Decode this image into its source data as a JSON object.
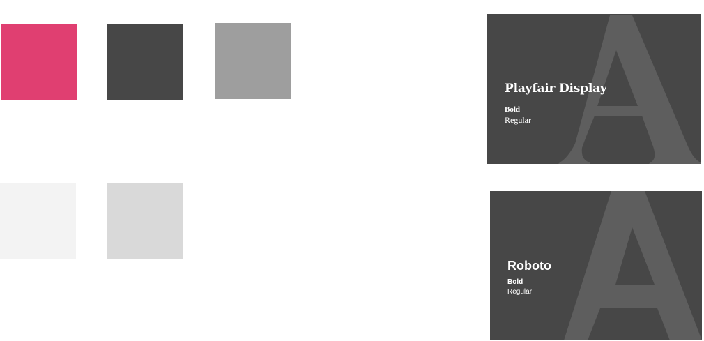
{
  "palette": {
    "swatches": [
      {
        "name": "pink",
        "color": "#E03F71"
      },
      {
        "name": "dark-grey",
        "color": "#474747"
      },
      {
        "name": "mid-grey",
        "color": "#9E9E9E"
      },
      {
        "name": "off-white",
        "color": "#F3F3F3"
      },
      {
        "name": "light-grey",
        "color": "#D9D9D9"
      }
    ]
  },
  "typography": {
    "card_background": "#474747",
    "glyph_color": "#5E5E5E",
    "text_color": "#FFFFFF",
    "cards": [
      {
        "font_name": "Playfair Display",
        "weights": [
          "Bold",
          "Regular"
        ],
        "glyph": "serif-letter-A"
      },
      {
        "font_name": "Roboto",
        "weights": [
          "Bold",
          "Regular"
        ],
        "glyph": "sans-letter-A"
      }
    ]
  }
}
